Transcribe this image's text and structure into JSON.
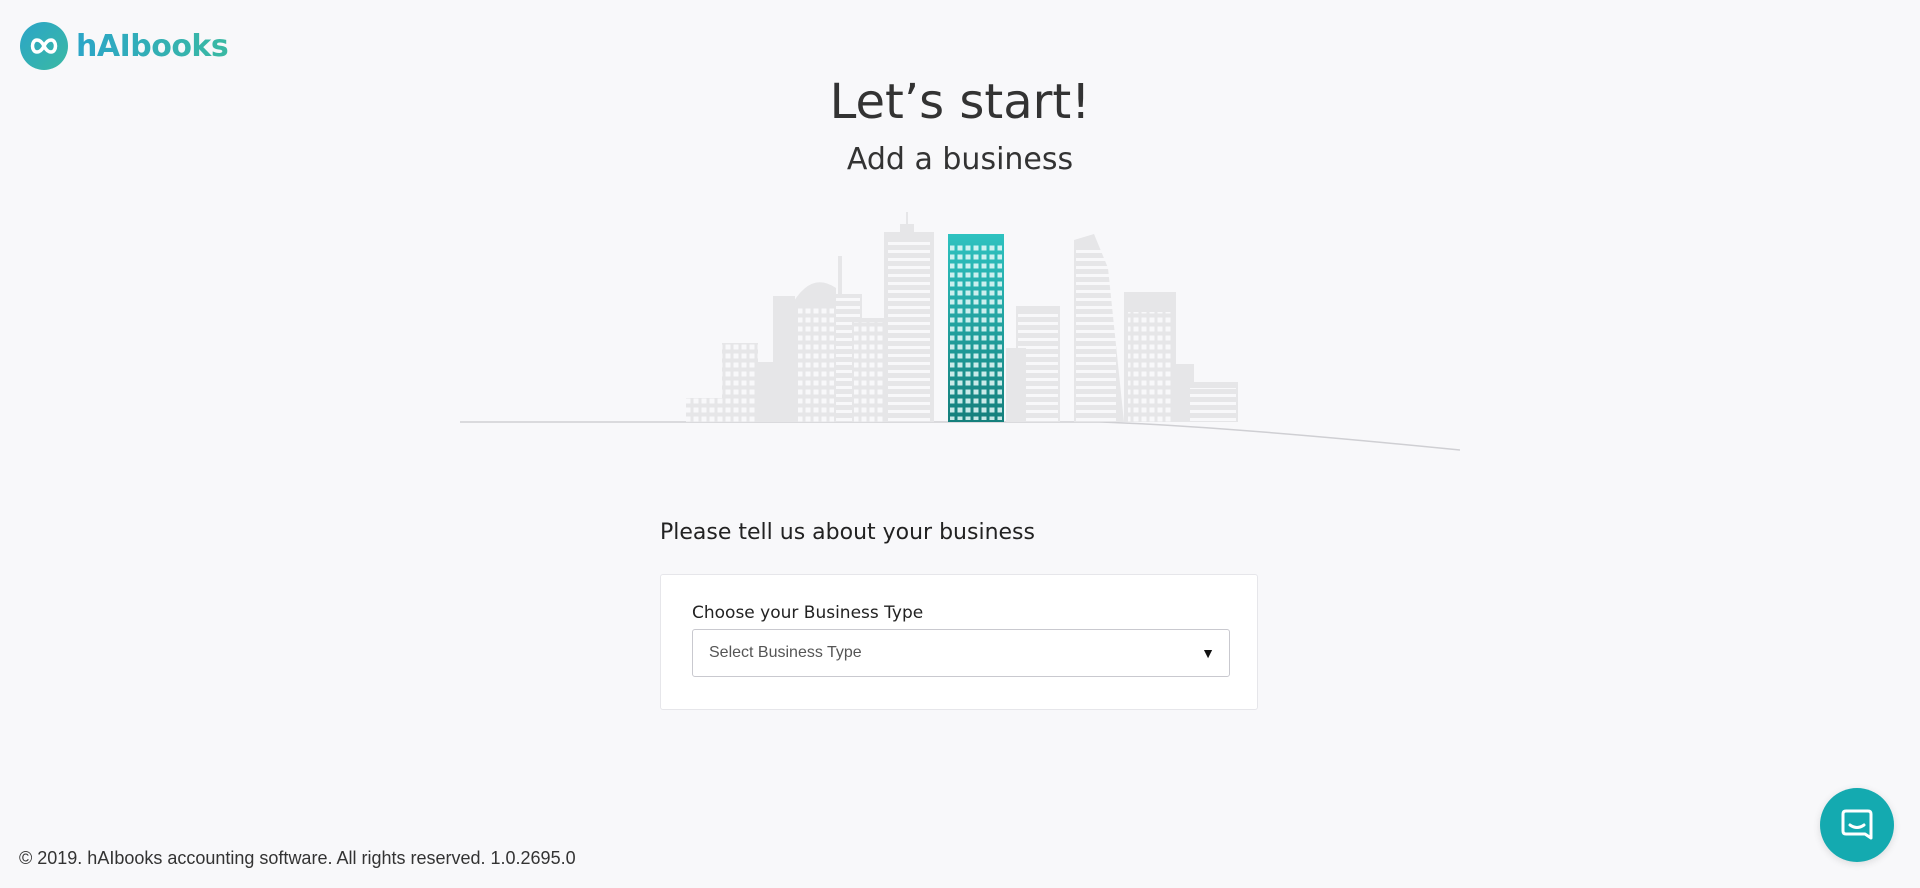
{
  "brand": {
    "name": "hAIbooks",
    "icon": "infinity-icon",
    "gradient_start": "#2ba5c8",
    "gradient_end": "#3ab9a3"
  },
  "hero": {
    "title": "Let’s start!",
    "subtitle": "Add a business",
    "illustration": "city-skyline-illustration",
    "highlight_color": "#2bb6b4"
  },
  "form": {
    "heading": "Please tell us about your business",
    "business_type": {
      "label": "Choose your Business Type",
      "selected": "Select Business Type",
      "arrow_icon": "caret-down-icon"
    }
  },
  "footer": {
    "copyright": "© 2019. hAIbooks accounting software. All rights reserved. 1.0.2695.0"
  },
  "chat": {
    "icon": "chat-bubble-icon",
    "color": "#14aab0"
  }
}
